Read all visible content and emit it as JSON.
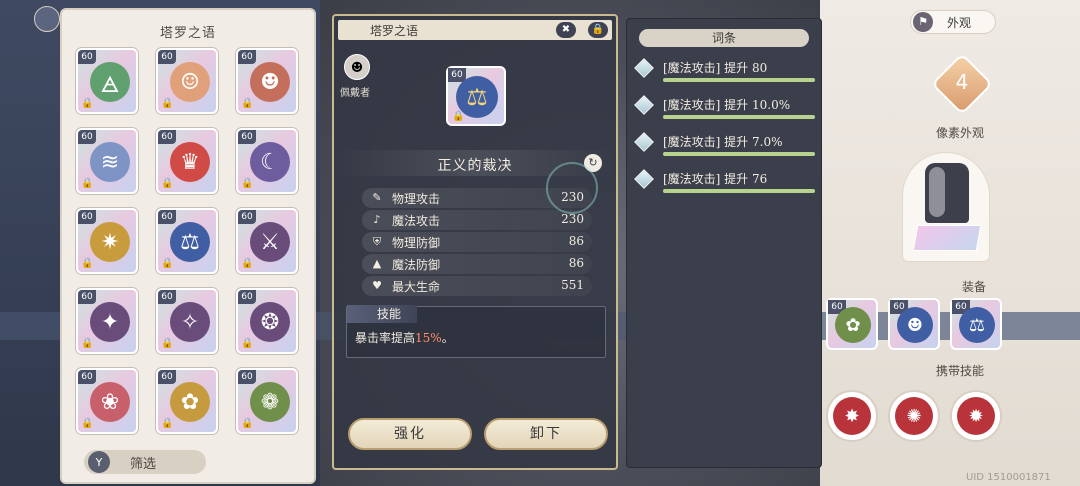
{
  "inventory": {
    "title": "塔罗之语",
    "filter_label": "筛选",
    "filter_icon": "funnel-icon",
    "level_label": "60",
    "lock_glyph": "🔒",
    "cards": [
      {
        "art": "🜁",
        "color": "#5fa06e"
      },
      {
        "art": "☺",
        "color": "#e0a07a"
      },
      {
        "art": "☻",
        "color": "#c46f5c"
      },
      {
        "art": "≋",
        "color": "#7e94c4"
      },
      {
        "art": "♛",
        "color": "#d14b46"
      },
      {
        "art": "☾",
        "color": "#6d5c9e"
      },
      {
        "art": "✷",
        "color": "#c89b3c"
      },
      {
        "art": "⚖",
        "color": "#3f5ea3"
      },
      {
        "art": "⚔",
        "color": "#6a4c7a"
      },
      {
        "art": "✦",
        "color": "#6a4c7a"
      },
      {
        "art": "✧",
        "color": "#6a4c7a"
      },
      {
        "art": "❂",
        "color": "#6a4c7a"
      },
      {
        "art": "❀",
        "color": "#c7606b"
      },
      {
        "art": "✿",
        "color": "#c69a3f"
      },
      {
        "art": "❁",
        "color": "#6f8f4a"
      }
    ]
  },
  "detail": {
    "header_title": "塔罗之语",
    "close_glyph": "✖",
    "lock_glyph": "🔒",
    "owner_label": "佩戴者",
    "owner_avatar_glyph": "☻",
    "item_level": "60",
    "item_art": "⚖",
    "item_name": "正义的裁决",
    "refresh_glyph": "↻",
    "stats": [
      {
        "icon": "✎",
        "label": "物理攻击",
        "value": "230"
      },
      {
        "icon": "♪",
        "label": "魔法攻击",
        "value": "230"
      },
      {
        "icon": "⛨",
        "label": "物理防御",
        "value": "86"
      },
      {
        "icon": "▲",
        "label": "魔法防御",
        "value": "86"
      },
      {
        "icon": "♥",
        "label": "最大生命",
        "value": "551"
      }
    ],
    "skill_title": "技能",
    "skill_text_prefix": "暴击率提高",
    "skill_text_highlight": "15%",
    "skill_text_suffix": "。",
    "enhance_label": "强化",
    "unequip_label": "卸下"
  },
  "affixes": {
    "title": "词条",
    "items": [
      {
        "text": "[魔法攻击] 提升 80",
        "fill": 1.0
      },
      {
        "text": "[魔法攻击] 提升 10.0%",
        "fill": 1.0
      },
      {
        "text": "[魔法攻击] 提升 7.0%",
        "fill": 1.0
      },
      {
        "text": "[魔法攻击] 提升 76",
        "fill": 1.0
      }
    ]
  },
  "right": {
    "appearance_label": "外观",
    "appearance_icon": "shirt-icon",
    "heart_level": "4",
    "pixel_label": "像素外观",
    "equipment_label": "装备",
    "carry_skill_label": "携带技能",
    "equip_cards": [
      {
        "level": "60",
        "art": "✿",
        "color": "#6f8f4a"
      },
      {
        "level": "60",
        "art": "☻",
        "color": "#3f5ea3"
      },
      {
        "level": "60",
        "art": "⚖",
        "color": "#3f5ea3"
      }
    ],
    "skills": [
      {
        "glyph": "✸",
        "color": "#b8333a"
      },
      {
        "glyph": "✺",
        "color": "#b8333a"
      },
      {
        "glyph": "✹",
        "color": "#b8333a"
      }
    ],
    "uid_text": "UID 1510001871"
  }
}
